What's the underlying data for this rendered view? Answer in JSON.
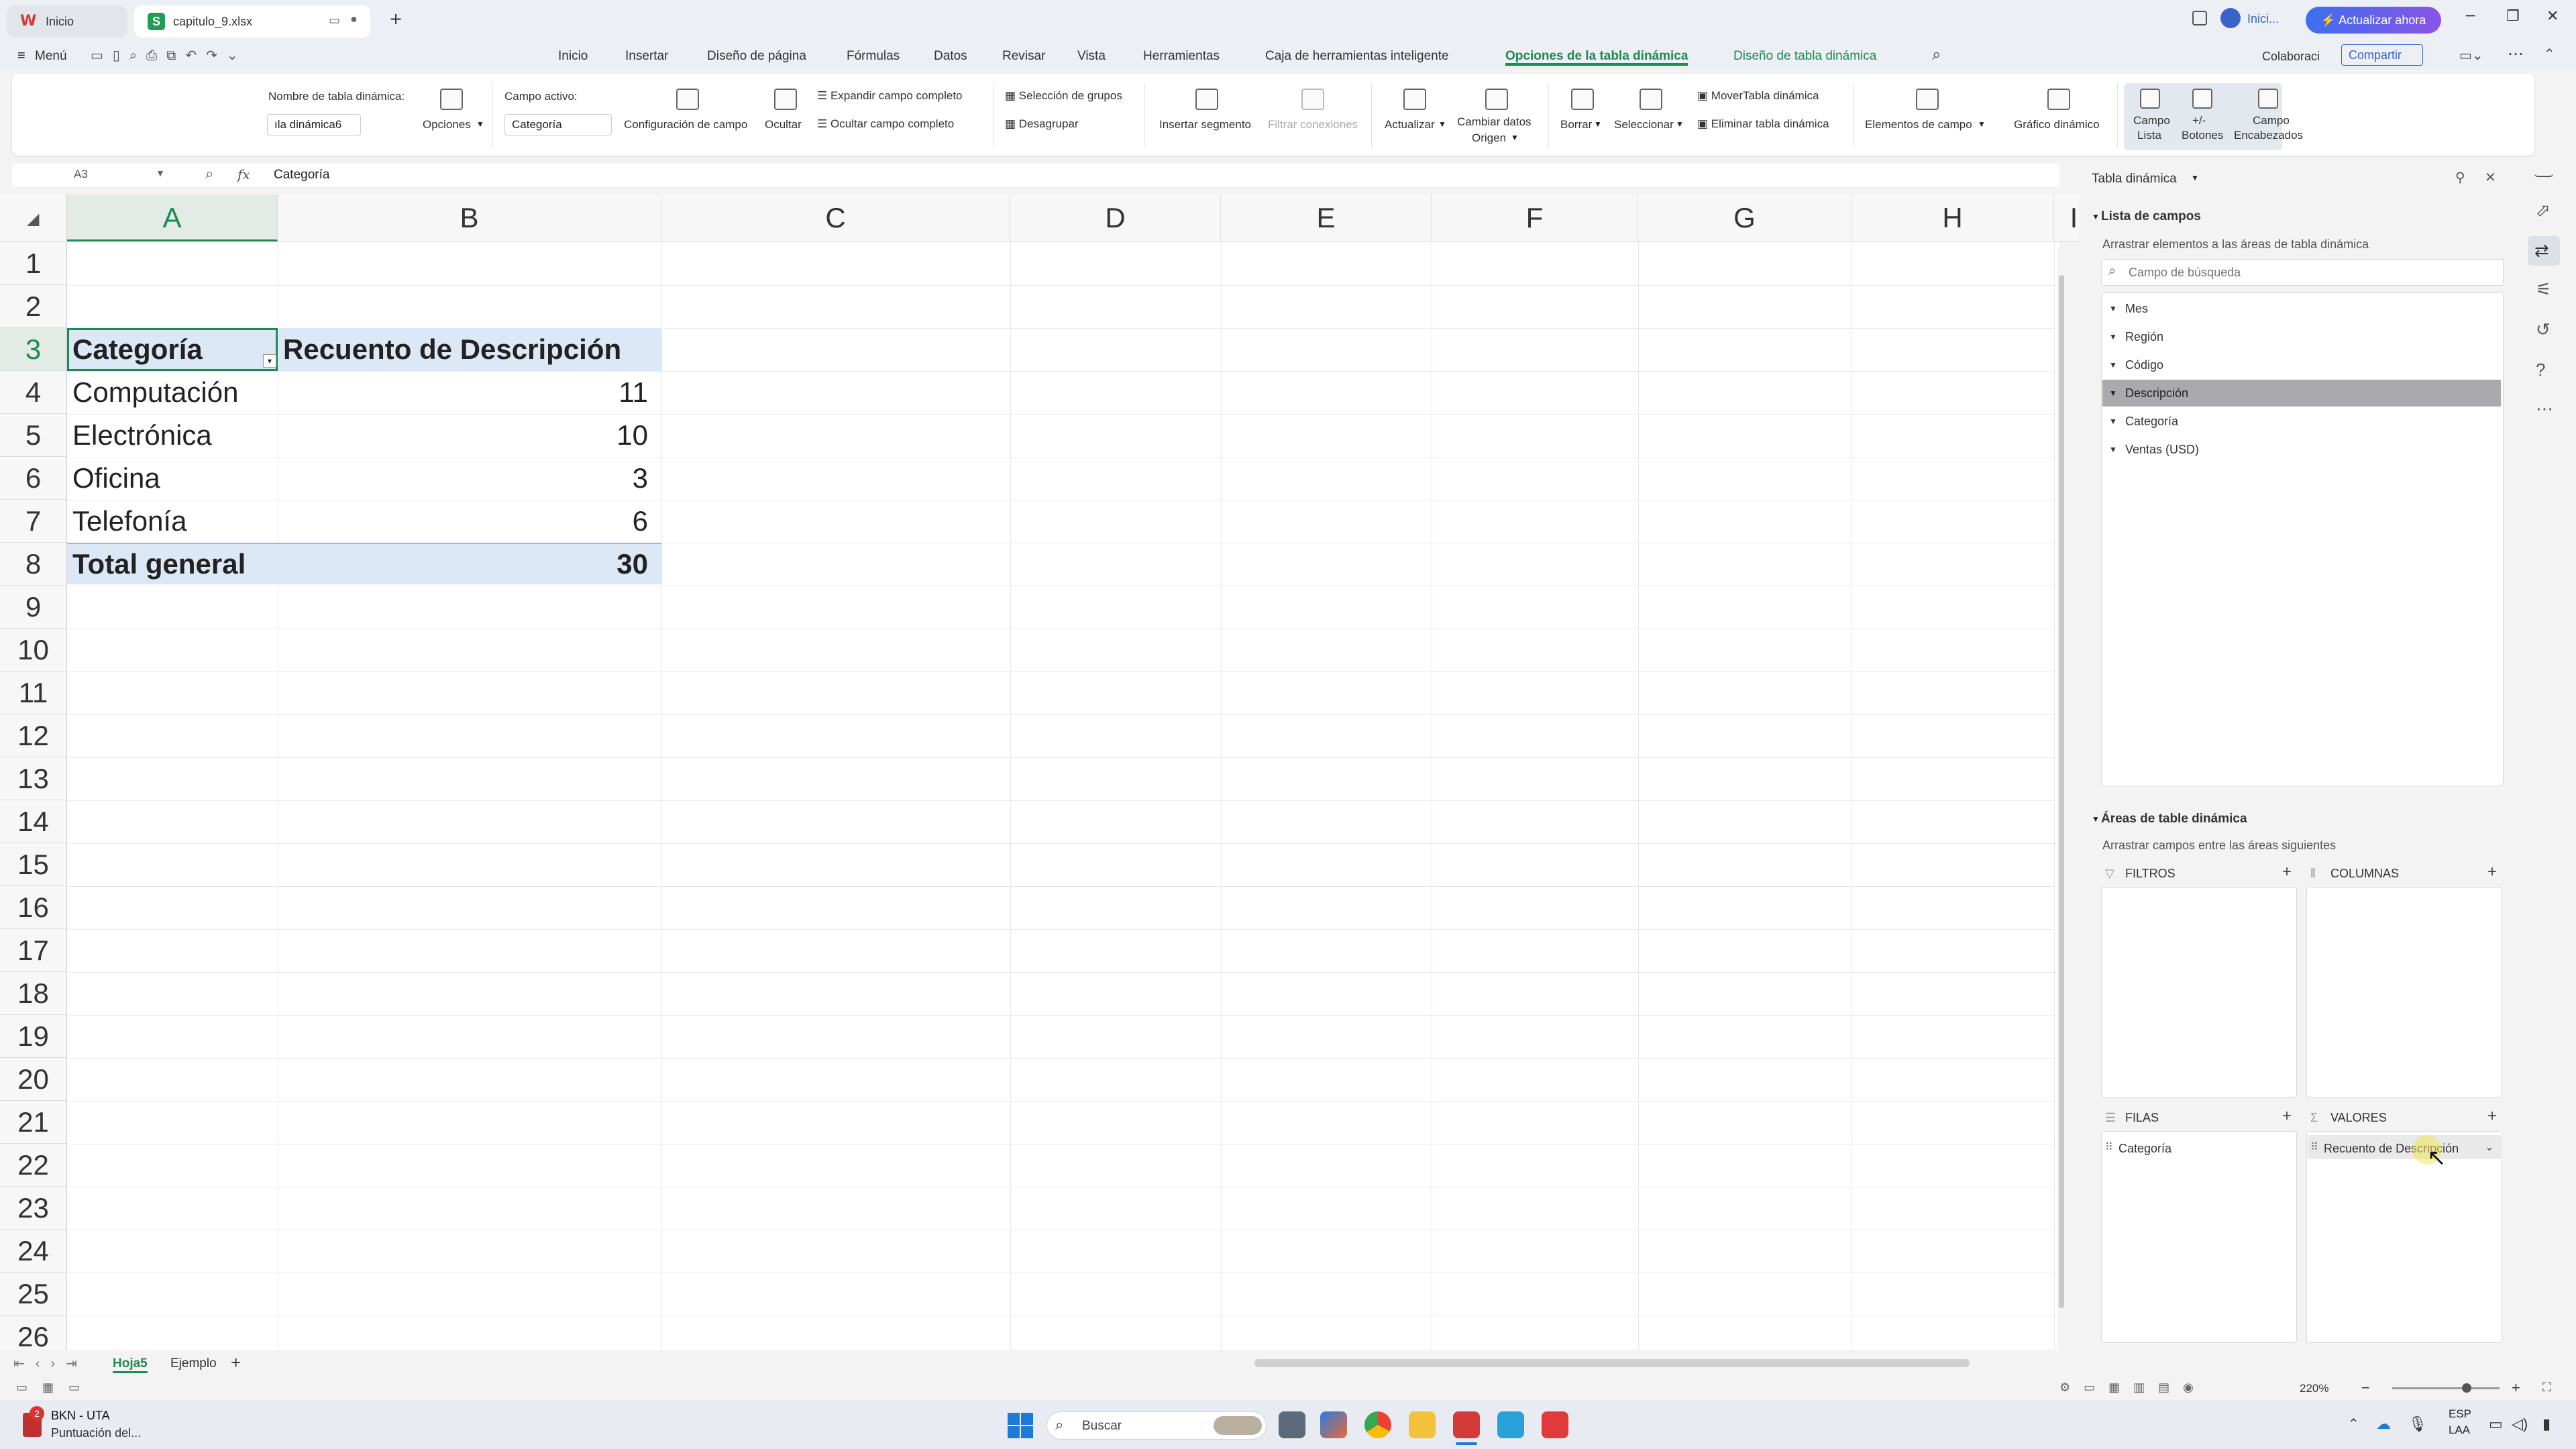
{
  "titlebar": {
    "home_tab": "Inicio",
    "file_tab": "capitulo_9.xlsx",
    "new_tab": "+",
    "account_label": "Inici...",
    "upgrade_button": "⚡ Actualizar ahora",
    "minimize": "─",
    "restore": "❐",
    "close": "✕"
  },
  "menubar": {
    "menu_label": "Menú",
    "tabs": [
      "Inicio",
      "Insertar",
      "Diseño de página",
      "Fórmulas",
      "Datos",
      "Revisar",
      "Vista",
      "Herramientas",
      "Caja de herramientas inteligente",
      "Opciones de la tabla dinámica",
      "Diseño de tabla dinámica"
    ],
    "active_tab": "Opciones de la tabla dinámica",
    "collaborate": "Colaboraci",
    "share": "Compartir"
  },
  "ribbon": {
    "pivot_name_label": "Nombre de tabla dinámica:",
    "pivot_name_value": "ıla dinámica6",
    "options": "Opciones",
    "active_field_label": "Campo activo:",
    "active_field_value": "Categoría",
    "field_settings": "Configuración de campo",
    "hide": "Ocultar",
    "expand_field": "Expandir campo completo",
    "collapse_field": "Ocultar campo completo",
    "group_selection": "Selección de grupos",
    "ungroup": "Desagrupar",
    "insert_slicer": "Insertar segmento",
    "filter_connections": "Filtrar conexiones",
    "refresh": "Actualizar",
    "change_source_1": "Cambiar datos",
    "change_source_2": "Origen",
    "clear": "Borrar",
    "select": "Seleccionar",
    "move_pivot": "MoverTabla dinámica",
    "delete_pivot": "Eliminar tabla dinámica",
    "field_items": "Elementos de campo",
    "pivot_chart": "Gráfico dinámico",
    "field_list_1": "Campo",
    "field_list_2": "Lista",
    "buttons_1": "+/-",
    "buttons_2": "Botones",
    "field_headers_1": "Campo",
    "field_headers_2": "Encabezados"
  },
  "formula_bar": {
    "cell_ref": "A3",
    "fx": "fx",
    "content": "Categoría"
  },
  "grid": {
    "columns": [
      "A",
      "B",
      "C",
      "D",
      "E",
      "F",
      "G",
      "H",
      "I"
    ],
    "rows": [
      "1",
      "2",
      "3",
      "4",
      "5",
      "6",
      "7",
      "8",
      "9",
      "10",
      "11",
      "12",
      "13",
      "14",
      "15",
      "16",
      "17",
      "18",
      "19",
      "20",
      "21",
      "22",
      "23",
      "24",
      "25",
      "26"
    ],
    "header_row": {
      "category": "Categoría",
      "count": "Recuento de Descripción"
    },
    "data_rows": [
      {
        "category": "Computación",
        "count": "11"
      },
      {
        "category": "Electrónica",
        "count": "10"
      },
      {
        "category": "Oficina",
        "count": "3"
      },
      {
        "category": "Telefonía",
        "count": "6"
      }
    ],
    "total_row": {
      "category": "Total general",
      "count": "30"
    }
  },
  "sheets": {
    "tabs": [
      "Hoja5",
      "Ejemplo"
    ],
    "active": "Hoja5",
    "add": "+"
  },
  "status": {
    "zoom": "220%"
  },
  "panel": {
    "title": "Tabla dinámica",
    "field_list_title": "Lista de campos",
    "field_list_hint": "Arrastrar elementos a las áreas de tabla dinámica",
    "search_placeholder": "Campo de búsqueda",
    "fields": [
      "Mes",
      "Región",
      "Código",
      "Descripción",
      "Categoría",
      "Ventas (USD)"
    ],
    "selected_field": "Descripción",
    "areas_title": "Áreas de table dinámica",
    "areas_hint": "Arrastrar campos entre las áreas siguientes",
    "filters": "FILTROS",
    "columns": "COLUMNAS",
    "rows": "FILAS",
    "values": "VALORES",
    "rows_item": "Categoría",
    "values_item": "Recuento de Descripción"
  },
  "taskbar": {
    "notif_title": "BKN - UTA",
    "notif_sub": "Puntuación del...",
    "notif_badge": "2",
    "search": "Buscar",
    "lang_1": "ESP",
    "lang_2": "LAA"
  },
  "colors": {
    "accent_green": "#1d8a52",
    "pivot_header_bg": "#dde8f7",
    "selected_field_bg": "#a9a9ae",
    "upgrade_gradient": [
      "#3d6ff0",
      "#8a54e6"
    ]
  }
}
